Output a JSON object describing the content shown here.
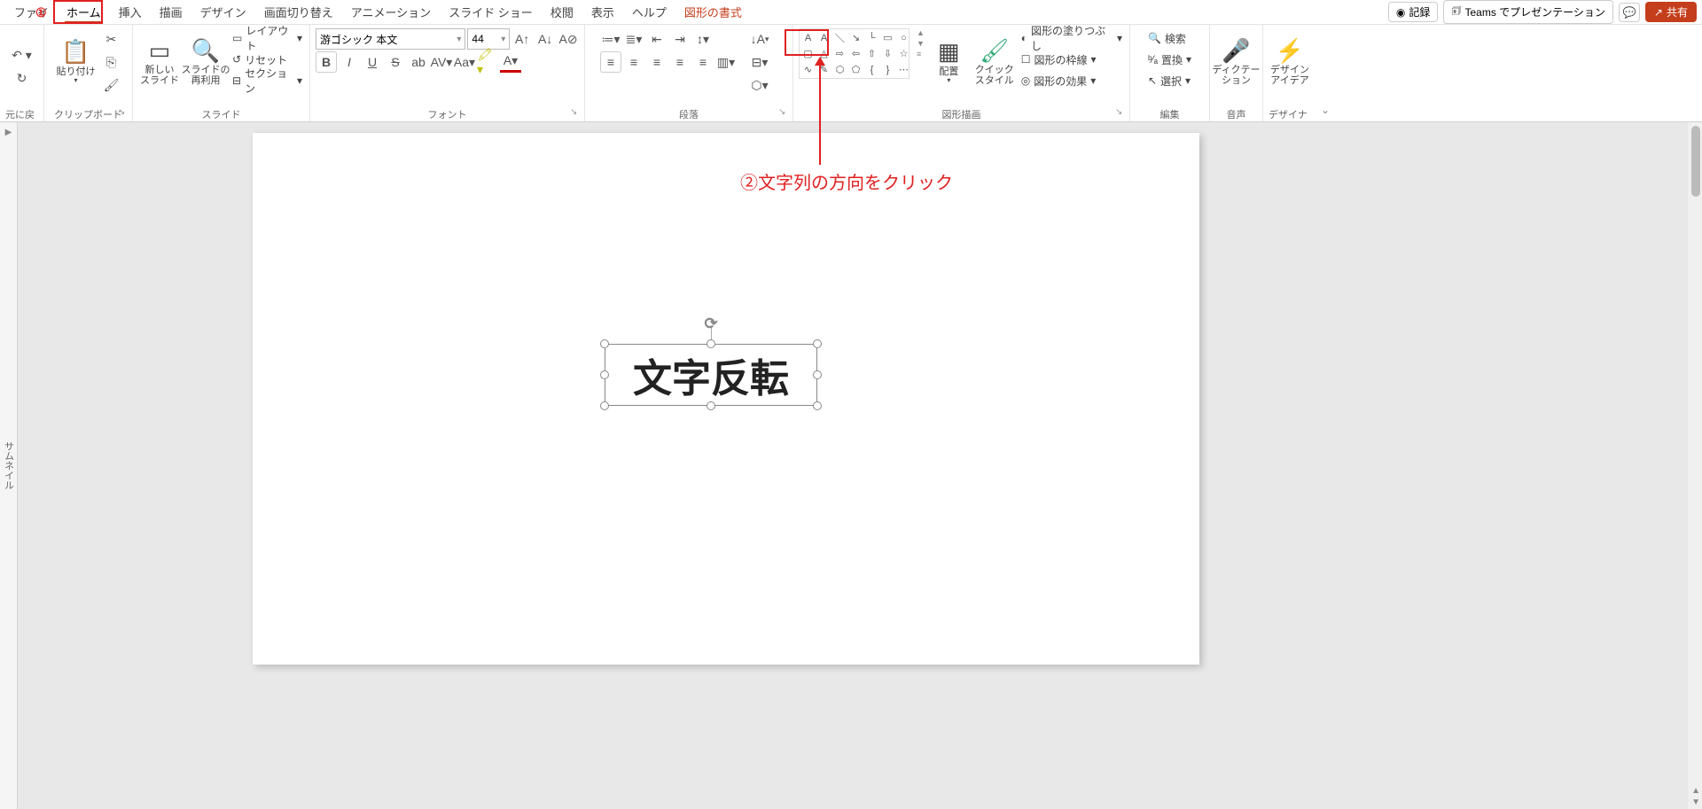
{
  "tabs": {
    "file": "ファイ",
    "home": "ホーム",
    "insert": "挿入",
    "draw": "描画",
    "design": "デザイン",
    "transitions": "画面切り替え",
    "animations": "アニメーション",
    "slideshow": "スライド ショー",
    "review": "校閲",
    "view": "表示",
    "help": "ヘルプ",
    "shape_format": "図形の書式"
  },
  "top_right": {
    "record": "記録",
    "teams": "Teams でプレゼンテーション",
    "share": "共有"
  },
  "ribbon": {
    "undo_group": "元に戻す",
    "clipboard": {
      "label": "クリップボード",
      "paste": "貼り付け"
    },
    "slides": {
      "label": "スライド",
      "new_slide": "新しい\nスライド",
      "reuse": "スライドの\n再利用",
      "layout": "レイアウト",
      "reset": "リセット",
      "section": "セクション"
    },
    "font": {
      "label": "フォント",
      "name": "游ゴシック 本文",
      "size": "44"
    },
    "paragraph": {
      "label": "段落"
    },
    "drawing": {
      "label": "図形描画",
      "arrange": "配置",
      "quick_styles": "クイック\nスタイル",
      "fill": "図形の塗りつぶし",
      "outline": "図形の枠線",
      "effects": "図形の効果"
    },
    "editing": {
      "label": "編集",
      "find": "検索",
      "replace": "置換",
      "select": "選択"
    },
    "voice": {
      "label": "音声",
      "dictation": "ディクテー\nション"
    },
    "designer": {
      "label": "デザイナー",
      "design_ideas": "デザイン\nアイデア"
    }
  },
  "thumbnail_label": "サムネイル",
  "textbox_content": "文字反転",
  "annotations": {
    "num1": "①",
    "num2_text": "②文字列の方向をクリック"
  }
}
